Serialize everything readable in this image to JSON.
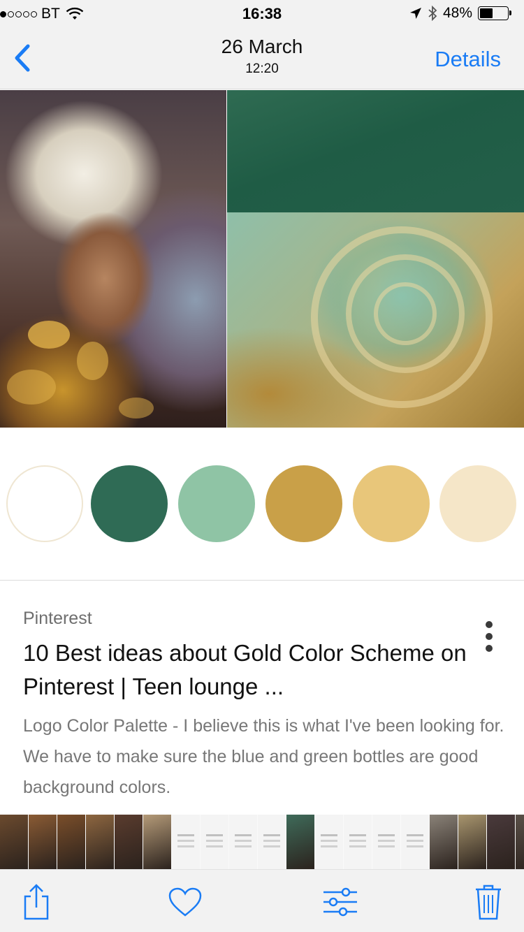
{
  "status_bar": {
    "carrier": "BT",
    "time": "16:38",
    "battery": "48%",
    "signal_bars_filled": 1,
    "signal_bars_total": 5,
    "battery_level": 0.48
  },
  "nav": {
    "back_icon": "chevron-left-icon",
    "date": "26 March",
    "time": "12:20",
    "details_label": "Details"
  },
  "palette": {
    "swatches": [
      {
        "name": "white",
        "color": "#ffffff",
        "border": "#efe6d2"
      },
      {
        "name": "dark-green",
        "color": "#2f6b55"
      },
      {
        "name": "mint",
        "color": "#8fc4a5"
      },
      {
        "name": "gold-glitter",
        "color": "#c9a048"
      },
      {
        "name": "mustard",
        "color": "#e8c67a"
      },
      {
        "name": "cream",
        "color": "#f5e6c8"
      }
    ]
  },
  "card": {
    "source": "Pinterest",
    "title": "10 Best ideas about Gold Color Scheme on Pinterest | Teen lounge ...",
    "description": "Logo Color Palette - I believe this is what I've been looking for. We have to make sure the blue and green bottles are good background colors.",
    "menu_icon": "more-vertical-icon"
  },
  "toolbar": {
    "items": [
      "share-icon",
      "heart-icon",
      "adjust-icon",
      "trash-icon"
    ]
  },
  "accent_color": "#1a7cf5"
}
